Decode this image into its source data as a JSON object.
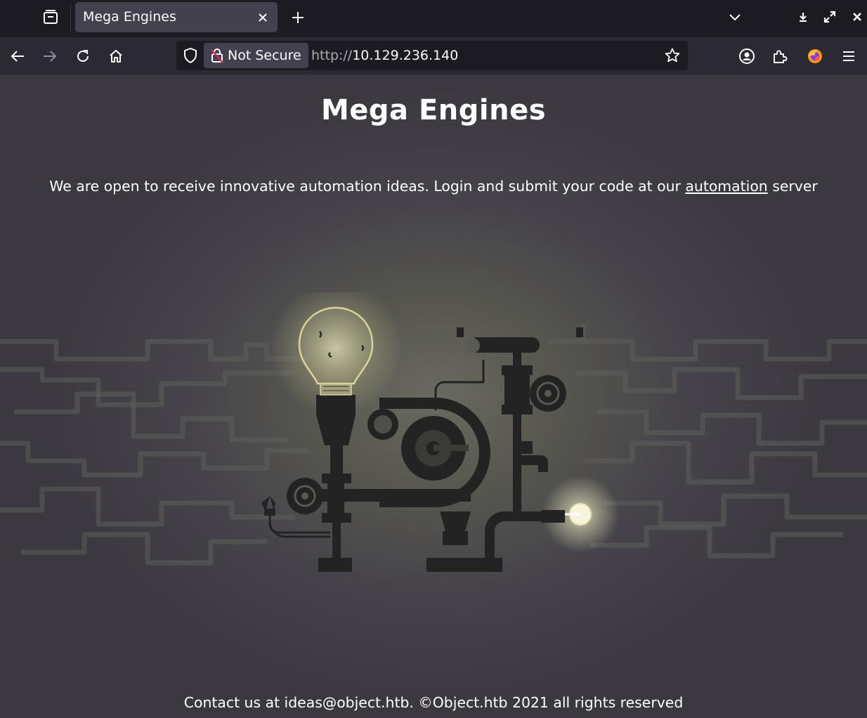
{
  "browser": {
    "tab": {
      "title": "Mega Engines"
    },
    "urlbar": {
      "security_label": "Not Secure",
      "url_scheme": "http://",
      "url_host": "10.129.236.140"
    },
    "icons": {
      "tab_list": "tab-list-icon",
      "tab_close": "close-icon",
      "new_tab": "plus-icon",
      "tab_overflow": "chevron-down-icon",
      "minimize": "minimize-icon",
      "maximize": "maximize-icon",
      "window_close": "close-icon",
      "back": "arrow-left-icon",
      "forward": "arrow-right-icon",
      "reload": "reload-icon",
      "home": "home-icon",
      "tracking": "shield-icon",
      "lock": "lock-broken-icon",
      "bookmark": "star-icon",
      "account": "account-icon",
      "extensions": "puzzle-icon",
      "firefox": "firefox-icon",
      "menu": "hamburger-icon"
    },
    "colors": {
      "toolbar": "#2b2a33",
      "tabstrip": "#1c1b22",
      "active_tab": "#42414d"
    }
  },
  "page": {
    "heading": "Mega Engines",
    "intro_before": "We are open to receive innovative automation ideas. Login and submit your code at our ",
    "intro_link": "automation",
    "intro_after": " server",
    "footer": "Contact us at ideas@object.htb. ©Object.htb 2021 all rights reserved",
    "colors": {
      "text": "#ffffff",
      "machine": "#232323",
      "bulb_glow": "#e6e2b0"
    }
  }
}
